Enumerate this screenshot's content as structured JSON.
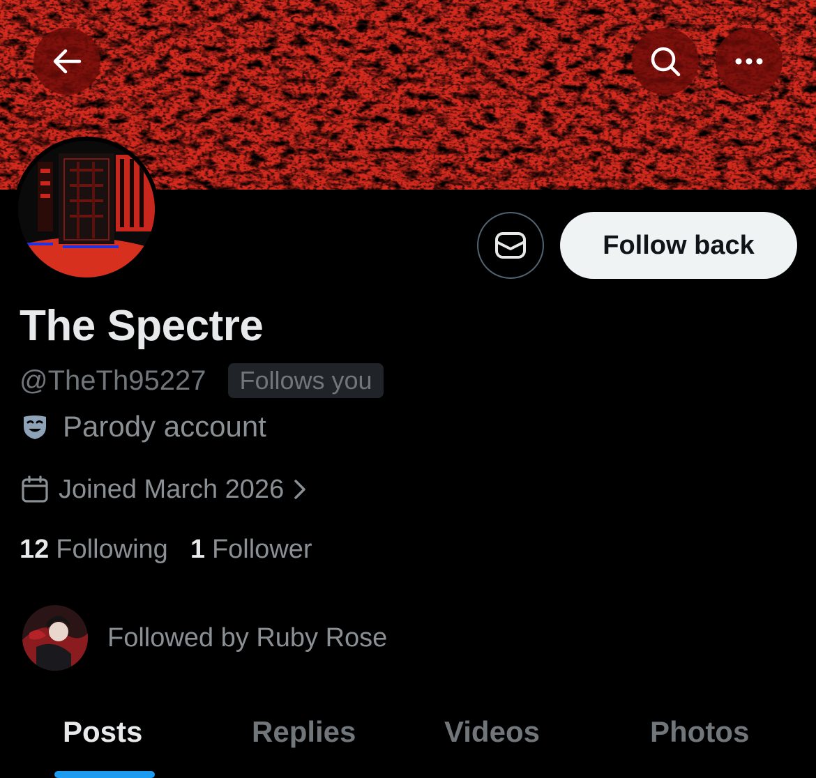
{
  "header": {
    "back_icon": "arrow-left-icon",
    "search_icon": "search-icon",
    "more_icon": "more-horizontal-icon",
    "banner_color": "#c8271e"
  },
  "profile": {
    "name": "The Spectre",
    "handle": "@TheTh95227",
    "follows_you_badge": "Follows you",
    "parody_label": "Parody account",
    "joined": "Joined March 2026",
    "following_count": "12",
    "following_label": "Following",
    "followers_count": "1",
    "followers_label": "Follower",
    "followed_by": "Followed by Ruby Rose"
  },
  "actions": {
    "message_icon": "envelope-icon",
    "follow_label": "Follow back"
  },
  "tabs": [
    {
      "label": "Posts",
      "active": true
    },
    {
      "label": "Replies",
      "active": false
    },
    {
      "label": "Videos",
      "active": false
    },
    {
      "label": "Photos",
      "active": false
    }
  ],
  "colors": {
    "accent": "#1d9bf0",
    "background": "#000000",
    "secondary_text": "#71767b"
  }
}
